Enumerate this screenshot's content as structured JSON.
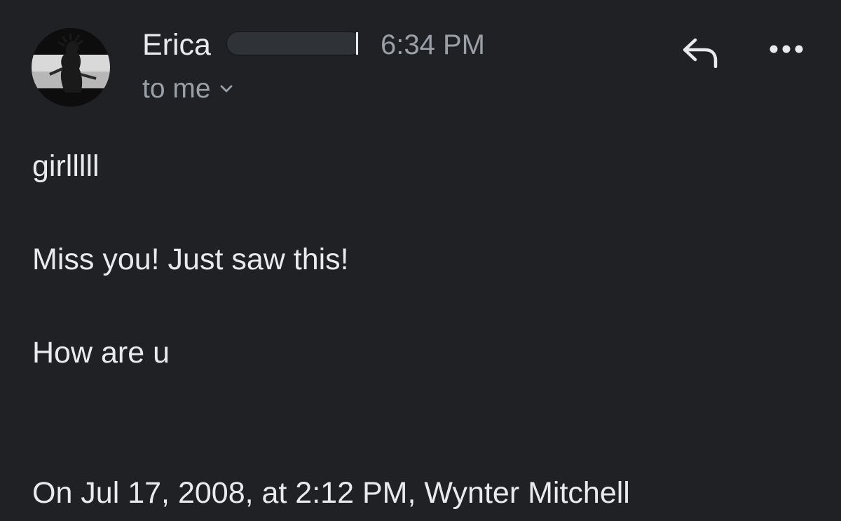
{
  "message": {
    "sender_name": "Erica",
    "time": "6:34 PM",
    "recipient_label": "to me",
    "body_lines": [
      "girlllll",
      "Miss you! Just saw this!",
      "How are u",
      "On Jul 17, 2008, at 2:12 PM, Wynter Mitchell"
    ]
  },
  "icons": {
    "reply": "reply-arrow-icon",
    "more": "more-horizontal-icon",
    "recipient_chevron": "chevron-down-icon"
  },
  "colors": {
    "background": "#202124",
    "primary_text": "#e8eaed",
    "secondary_text": "#9aa0a6"
  }
}
